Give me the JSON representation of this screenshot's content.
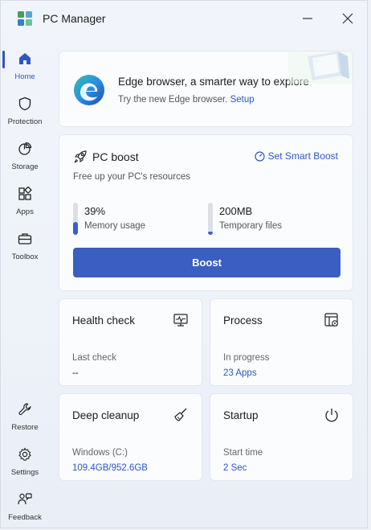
{
  "window": {
    "title": "PC Manager",
    "accent": "#2f55c7"
  },
  "sidebar": {
    "items": [
      {
        "label": "Home",
        "icon": "home-icon",
        "active": true
      },
      {
        "label": "Protection",
        "icon": "shield-icon",
        "active": false
      },
      {
        "label": "Storage",
        "icon": "pie-chart-icon",
        "active": false
      },
      {
        "label": "Apps",
        "icon": "apps-grid-icon",
        "active": false
      },
      {
        "label": "Toolbox",
        "icon": "toolbox-icon",
        "active": false
      }
    ],
    "bottom_items": [
      {
        "label": "Restore",
        "icon": "wrench-icon"
      },
      {
        "label": "Settings",
        "icon": "gear-icon"
      },
      {
        "label": "Feedback",
        "icon": "feedback-icon"
      }
    ]
  },
  "promo": {
    "title": "Edge browser, a smarter way to explore",
    "subtitle": "Try the new Edge browser.",
    "link": "Setup"
  },
  "boost": {
    "title": "PC boost",
    "smart_boost_link": "Set Smart Boost",
    "subtitle": "Free up your PC's resources",
    "memory_value": "39%",
    "memory_label": "Memory usage",
    "memory_fraction": 0.39,
    "temp_value": "200MB",
    "temp_label": "Temporary files",
    "temp_fraction": 0.1,
    "button_label": "Boost"
  },
  "tiles": {
    "health": {
      "title": "Health check",
      "sub": "Last check",
      "value": "--"
    },
    "process": {
      "title": "Process",
      "sub": "In progress",
      "value": "23 Apps"
    },
    "deep": {
      "title": "Deep cleanup",
      "sub": "Windows (C:)",
      "value": "109.4GB/952.6GB"
    },
    "startup": {
      "title": "Startup",
      "sub": "Start time",
      "value": "2 Sec"
    }
  }
}
